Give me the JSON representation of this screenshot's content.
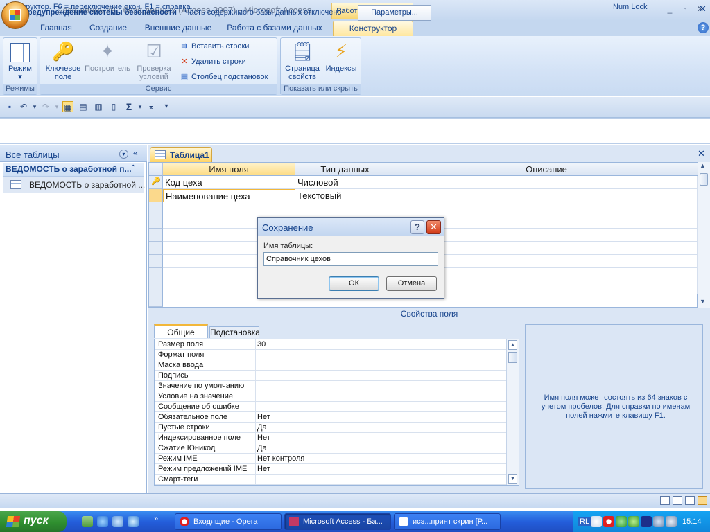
{
  "window": {
    "title": "База данных9 : база данных (Access 2007) - Microsoft Access",
    "context_tab_title": "Работа с таблицами",
    "controls": {
      "minimize": "_",
      "maximize": "▫",
      "close": "✕"
    }
  },
  "ribbon_tabs": [
    "Главная",
    "Создание",
    "Внешние данные",
    "Работа с базами данных",
    "Конструктор"
  ],
  "ribbon": {
    "groups": {
      "modes": "Режимы",
      "service": "Сервис",
      "show_hide": "Показать или скрыть"
    },
    "buttons": {
      "mode": "Режим",
      "key_field_1": "Ключевое",
      "key_field_2": "поле",
      "builder": "Построитель",
      "test_rules_1": "Проверка",
      "test_rules_2": "условий",
      "insert_rows": "Вставить строки",
      "delete_rows": "Удалить строки",
      "lookup_column": "Столбец  подстановок",
      "property_sheet_1": "Страница",
      "property_sheet_2": "свойств",
      "indexes": "Индексы"
    }
  },
  "security_bar": {
    "title": "Предупреждение системы безопасности",
    "message": "Часть содержимого базы данных отключено",
    "button": "Параметры..."
  },
  "nav_pane": {
    "title": "Все таблицы",
    "group": "ВЕДОМОСТЬ о заработной п...",
    "items": [
      "ВЕДОМОСТЬ о заработной ..."
    ]
  },
  "document": {
    "tab": "Таблица1",
    "columns": [
      "Имя поля",
      "Тип данных",
      "Описание"
    ],
    "rows": [
      {
        "name": "Код цеха",
        "type": "Числовой",
        "desc": ""
      },
      {
        "name": "Наименование цеха",
        "type": "Текстовый",
        "desc": ""
      }
    ],
    "properties_header": "Свойства поля"
  },
  "properties": {
    "tabs": [
      "Общие",
      "Подстановка"
    ],
    "rows": [
      {
        "name": "Размер поля",
        "value": "30"
      },
      {
        "name": "Формат поля",
        "value": ""
      },
      {
        "name": "Маска ввода",
        "value": ""
      },
      {
        "name": "Подпись",
        "value": ""
      },
      {
        "name": "Значение по умолчанию",
        "value": ""
      },
      {
        "name": "Условие на значение",
        "value": ""
      },
      {
        "name": "Сообщение об ошибке",
        "value": ""
      },
      {
        "name": "Обязательное поле",
        "value": "Нет"
      },
      {
        "name": "Пустые строки",
        "value": "Да"
      },
      {
        "name": "Индексированное поле",
        "value": "Нет"
      },
      {
        "name": "Сжатие Юникод",
        "value": "Да"
      },
      {
        "name": "Режим IME",
        "value": "Нет контроля"
      },
      {
        "name": "Режим предложений IME",
        "value": "Нет"
      },
      {
        "name": "Смарт-теги",
        "value": ""
      }
    ],
    "help_text": "Имя поля может состоять из 64 знаков с учетом пробелов.  Для справки по именам полей нажмите клавишу F1."
  },
  "dialog": {
    "title": "Сохранение",
    "label": "Имя таблицы:",
    "value": "Справочник цехов",
    "ok": "ОК",
    "cancel": "Отмена"
  },
  "status_bar": {
    "text": "Конструктор.  F6 = переключение окон.  F1 = справка.",
    "numlock": "Num Lock"
  },
  "taskbar": {
    "start": "пуск",
    "buttons": [
      "Входящие - Opera",
      "Microsoft Access - Ба...",
      "исэ...принт скрин [Р..."
    ],
    "lang": "RL",
    "clock": "15:14"
  },
  "colors": {
    "accent": "#15428b",
    "ribbon_bg": "#d3e2f6",
    "context_tab": "#ffd466"
  }
}
